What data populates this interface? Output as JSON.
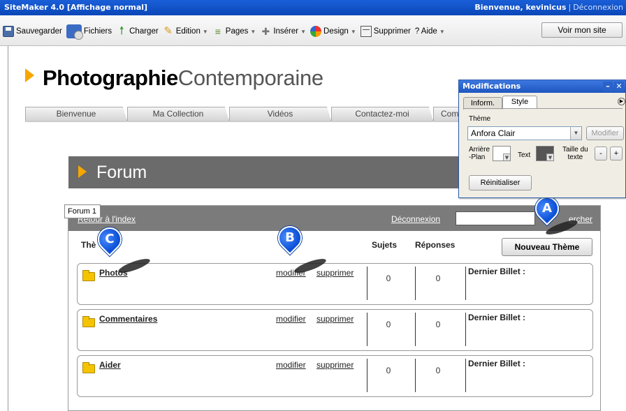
{
  "app": {
    "title": "SiteMaker 4.0  [Affichage normal]",
    "welcome": "Bienvenue, kevinicus",
    "separator": "|",
    "logout": "Déconnexion"
  },
  "toolbar": {
    "save": "Sauvegarder",
    "files": "Fichiers",
    "upload": "Charger",
    "edit": "Edition",
    "pages": "Pages",
    "insert": "Insérer",
    "design": "Design",
    "delete": "Supprimer",
    "help": "? Aide",
    "view_site": "Voir mon site"
  },
  "site": {
    "title_bold": "Photographie",
    "title_light": "Contemporaine",
    "nav": [
      "Bienvenue",
      "Ma Collection",
      "Vidéos",
      "Contactez-moi",
      "Com"
    ]
  },
  "forum": {
    "header": "Forum",
    "tag": "Forum 1",
    "back_link": "Retour à l'index",
    "logout_link": "Déconnexion",
    "search_link": "ercher",
    "col_theme": "Thè",
    "col_topics": "Sujets",
    "col_replies": "Réponses",
    "new_theme": "Nouveau Thème",
    "rows": [
      {
        "name": "Photos",
        "edit": "modifier",
        "delete": "supprimer",
        "topics": "0",
        "replies": "0",
        "last": "Dernier Billet :"
      },
      {
        "name": "Commentaires",
        "edit": "modifier",
        "delete": "supprimer",
        "topics": "0",
        "replies": "0",
        "last": "Dernier Billet :"
      },
      {
        "name": "Aider",
        "edit": "modifier",
        "delete": "supprimer",
        "topics": "0",
        "replies": "0",
        "last": "Dernier Billet :"
      }
    ]
  },
  "markers": {
    "a": "A",
    "b": "B",
    "c": "C"
  },
  "panel": {
    "title": "Modifications",
    "tabs": [
      "Inform.",
      "Style"
    ],
    "theme_label": "Thème",
    "theme_value": "Anfora Clair",
    "modify": "Modifier",
    "bg_label_1": "Arrière",
    "bg_label_2": "-Plan",
    "text_label": "Text",
    "size_label_1": "Taille du",
    "size_label_2": "texte",
    "minus": "-",
    "plus": "+",
    "reset": "Réinitialiser"
  },
  "colors": {
    "titlebar": "#0b47b8",
    "accent": "#f7a600",
    "forum_header": "#6b6b6b",
    "forum_bar": "#7b7b7b",
    "marker": "#0b4fd6"
  },
  "icons": [
    "save-icon",
    "files-icon",
    "upload-icon",
    "edit-icon",
    "pages-icon",
    "insert-icon",
    "design-icon",
    "delete-icon",
    "folder-icon",
    "minimize-icon",
    "close-icon",
    "arrow-right-icon"
  ]
}
